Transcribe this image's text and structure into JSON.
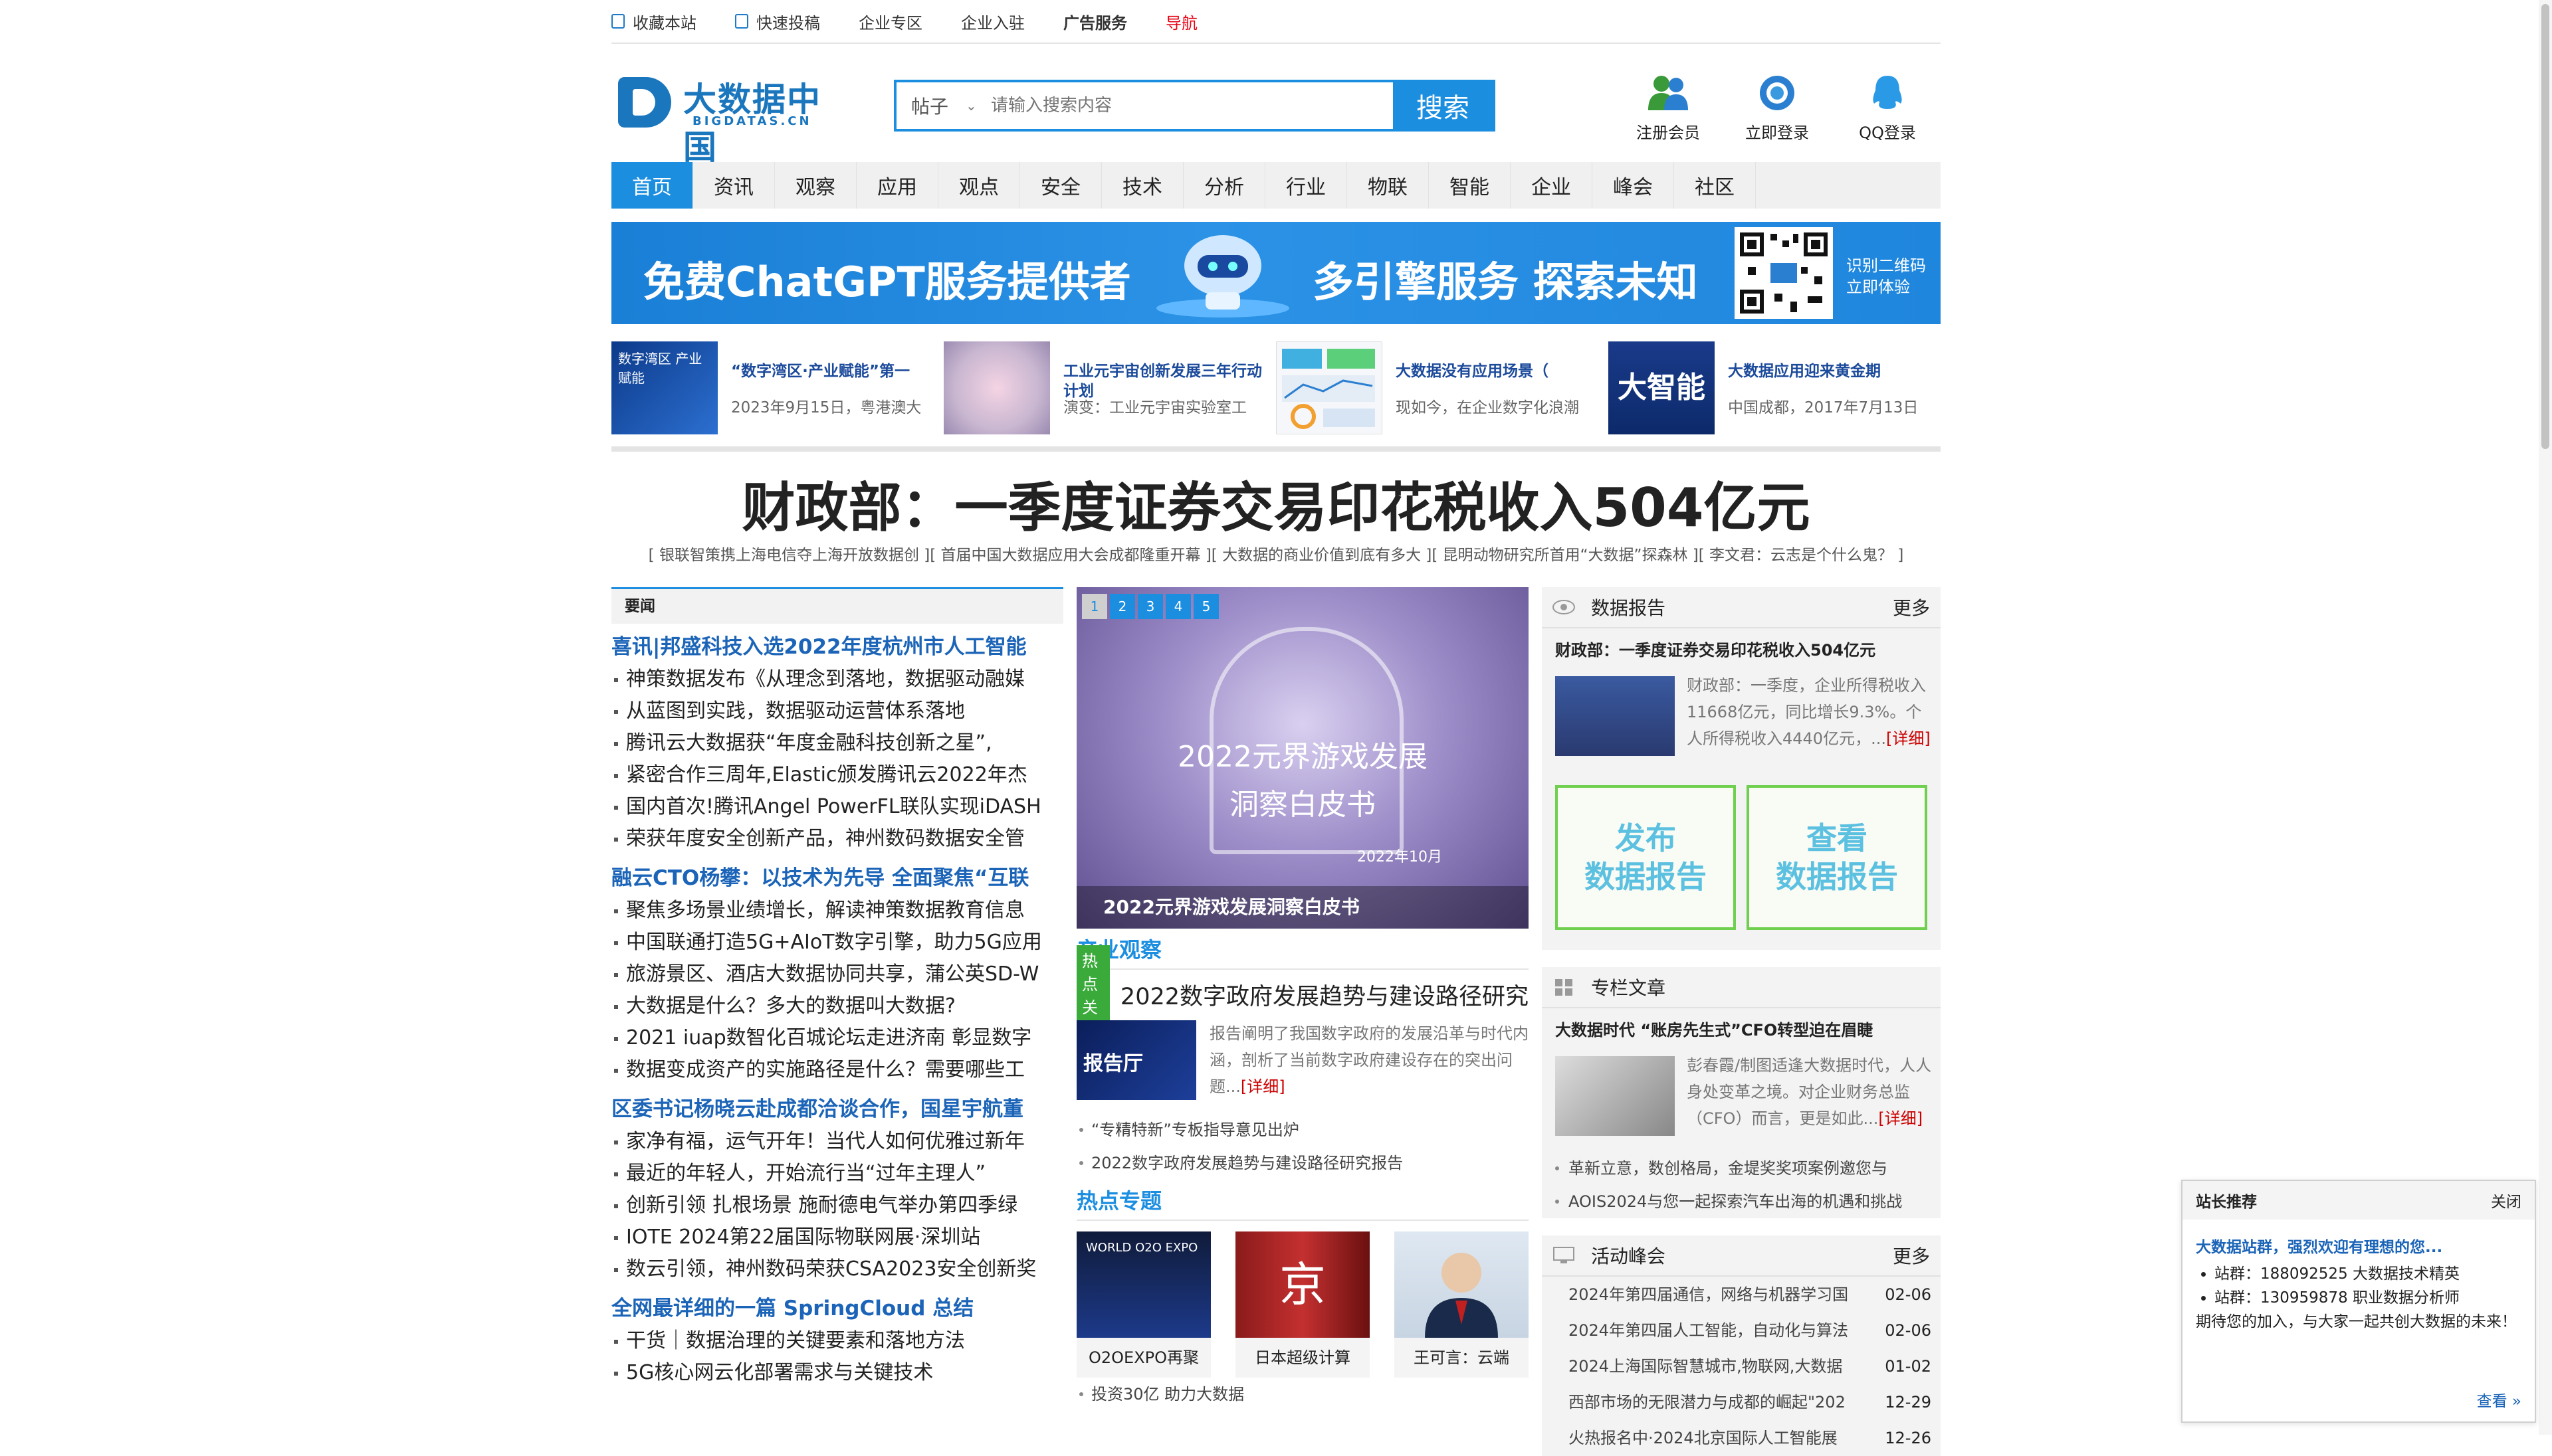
{
  "topbar": {
    "items": [
      "收藏本站",
      "快速投稿",
      "企业专区",
      "企业入驻",
      "广告服务",
      "导航"
    ]
  },
  "header": {
    "logo_title": "大数据中国",
    "logo_sub": "BIGDATAS.CN",
    "search_type": "帖子",
    "search_placeholder": "请输入搜索内容",
    "search_button": "搜索",
    "links": [
      "注册会员",
      "立即登录",
      "QQ登录"
    ]
  },
  "nav": {
    "items": [
      "首页",
      "资讯",
      "观察",
      "应用",
      "观点",
      "安全",
      "技术",
      "分析",
      "行业",
      "物联",
      "智能",
      "企业",
      "峰会",
      "社区"
    ]
  },
  "banner": {
    "text1": "免费ChatGPT服务提供者",
    "text2": "多引擎服务  探索未知",
    "qr_line1": "识别二维码",
    "qr_line2": "立即体验"
  },
  "strip": [
    {
      "title": "“数字湾区·产业赋能”第一",
      "desc": "2023年9月15日，粤港澳大"
    },
    {
      "title": "工业元宇宙创新发展三年行动计划",
      "desc": "演变：工业元宇宙实验室工"
    },
    {
      "title": "大数据没有应用场景（",
      "desc": "现如今，在企业数字化浪潮"
    },
    {
      "title": "大数据应用迎来黄金期",
      "desc": "中国成都，2017年7月13日"
    }
  ],
  "strip_img_text": {
    "img1": "数字湾区 产业赋能",
    "img4": "大智能"
  },
  "headline": {
    "title": "财政部：一季度证券交易印花税收入504亿元",
    "sublinks": "[ 银联智策携上海电信夺上海开放数据创 ][ 首届中国大数据应用大会成都隆重开幕 ][ 大数据的商业价值到底有多大 ][ 昆明动物研究所首用“大数据”探森林 ][ 李文君：云志是个什么鬼？ ]"
  },
  "left": {
    "header": "要闻",
    "groups": [
      {
        "lead": "喜讯|邦盛科技入选2022年度杭州市人工智能",
        "items": [
          "神策数据发布《从理念到落地，数据驱动融媒",
          "从蓝图到实践，数据驱动运营体系落地",
          "腾讯云大数据获“年度金融科技创新之星”,",
          "紧密合作三周年,Elastic颁发腾讯云2022年杰",
          "国内首次!腾讯Angel PowerFL联队实现iDASH",
          "荣获年度安全创新产品，神州数码数据安全管"
        ]
      },
      {
        "lead": "融云CTO杨攀：以技术为先导 全面聚焦“互联",
        "items": [
          "聚焦多场景业绩增长，解读神策数据教育信息",
          "中国联通打造5G+AIoT数字引擎，助力5G应用",
          "旅游景区、酒店大数据协同共享，蒲公英SD-W",
          "大数据是什么？多大的数据叫大数据?",
          "2021 iuap数智化百城论坛走进济南 彰显数字",
          "数据变成资产的实施路径是什么？需要哪些工"
        ]
      },
      {
        "lead": "区委书记杨晓云赴成都洽谈合作，国星宇航董",
        "items": [
          "家净有福，运气开年！当代人如何优雅过新年",
          "最近的年轻人，开始流行当“过年主理人”",
          "创新引领 扎根场景 施耐德电气举办第四季绿",
          "IOTE 2024第22届国际物联网展·深圳站",
          "数云引领，神州数码荣获CSA2023安全创新奖"
        ]
      },
      {
        "lead": "全网最详细的一篇 SpringCloud 总结",
        "items": [
          "干货｜数据治理的关键要素和落地方法",
          "5G核心网云化部署需求与关键技术"
        ]
      }
    ]
  },
  "mid": {
    "slider": {
      "pages": [
        "1",
        "2",
        "3",
        "4",
        "5"
      ],
      "title_line1": "2022元界游戏发展",
      "title_line2": "洞察白皮书",
      "date": "2022年10月",
      "caption": "2022元界游戏发展洞察白皮书"
    },
    "industry": {
      "title": "产业观察",
      "hot_badge": "热点关注",
      "hot_title": "2022数字政府发展趋势与建设路径研究",
      "img_text": "报告厅",
      "desc": "报告阐明了我国数字政府的发展沿革与时代内涵，剖析了当前数字政府建设存在的突出问题...",
      "more": "[详细]",
      "list": [
        "“专精特新”专板指导意见出炉",
        "2022数字政府发展趋势与建设路径研究报告"
      ]
    },
    "topics": {
      "title": "热点专题",
      "items": [
        "O2OEXPO再聚",
        "日本超级计算",
        "王可言：云端"
      ],
      "img1_text": "WORLD O2O EXPO",
      "img2_text": "京"
    },
    "bottom_item": "投资30亿 助力大数据"
  },
  "right": {
    "reports": {
      "title": "数据报告",
      "more": "更多",
      "lead": "财政部：一季度证券交易印花税收入504亿元",
      "desc": "财政部：一季度，企业所得税收入11668亿元，同比增长9.3%。个人所得税收入4440亿元，...",
      "detail": "[详细]",
      "btn1": "发布\n数据报告",
      "btn2": "查看\n数据报告"
    },
    "columns": {
      "title": "专栏文章",
      "lead": "大数据时代 “账房先生式”CFO转型迫在眉睫",
      "desc": "彭春霞/制图适逢大数据时代，人人身处变革之境。对企业财务总监（CFO）而言，更是如此...",
      "detail": "[详细]",
      "list": [
        "革新立意，数创格局，金堤奖奖项案例邀您与",
        "AOIS2024与您一起探索汽车出海的机遇和挑战"
      ]
    },
    "events": {
      "title": "活动峰会",
      "more": "更多",
      "items": [
        {
          "t": "2024年第四届通信，网络与机器学习国",
          "d": "02-06"
        },
        {
          "t": "2024年第四届人工智能，自动化与算法",
          "d": "02-06"
        },
        {
          "t": "2024上海国际智慧城市,物联网,大数据",
          "d": "01-02"
        },
        {
          "t": "西部市场的无限潜力与成都的崛起\"202",
          "d": "12-29"
        },
        {
          "t": "火热报名中·2024北京国际人工智能展",
          "d": "12-26"
        }
      ]
    }
  },
  "popup": {
    "title": "站长推荐",
    "close": "关闭",
    "lead": "大数据站群，强烈欢迎有理想的您...",
    "items": [
      "站群：188092525 大数据技术精英",
      "站群：130959878 职业数据分析师"
    ],
    "para": "期待您的加入，与大家一起共创大数据的未来！",
    "more": "查看 »"
  },
  "colors": {
    "accent": "#1c8ee0",
    "link": "#1b64b8",
    "alert": "#e60012",
    "green": "#6fcf4e"
  }
}
